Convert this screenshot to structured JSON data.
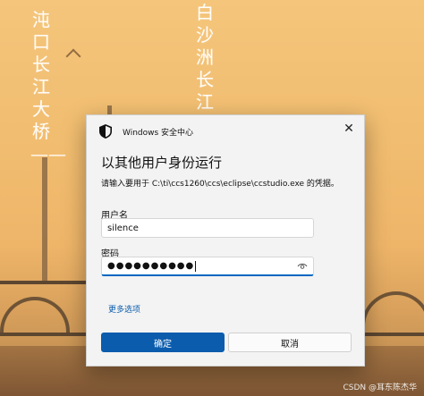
{
  "background": {
    "poem_left": "沌口长江大桥——",
    "poem_right": "白沙洲长江大桥",
    "watermark": "CSDN @耳东陈杰华"
  },
  "dialog": {
    "window_title": "Windows 安全中心",
    "heading": "以其他用户身份运行",
    "description": "请输入要用于 C:\\ti\\ccs1260\\ccs\\eclipse\\ccstudio.exe 的凭据。",
    "username_label": "用户名",
    "username_value": "silence",
    "password_label": "密码",
    "password_mask": "●●●●●●●●●●",
    "more_options": "更多选项",
    "ok_label": "确定",
    "cancel_label": "取消",
    "close_glyph": "✕"
  },
  "colors": {
    "accent": "#0b5cad",
    "background_sky": "#f1bd70"
  },
  "icons": {
    "shield": "shield-icon",
    "close": "close-icon",
    "reveal_password": "eye-icon"
  }
}
